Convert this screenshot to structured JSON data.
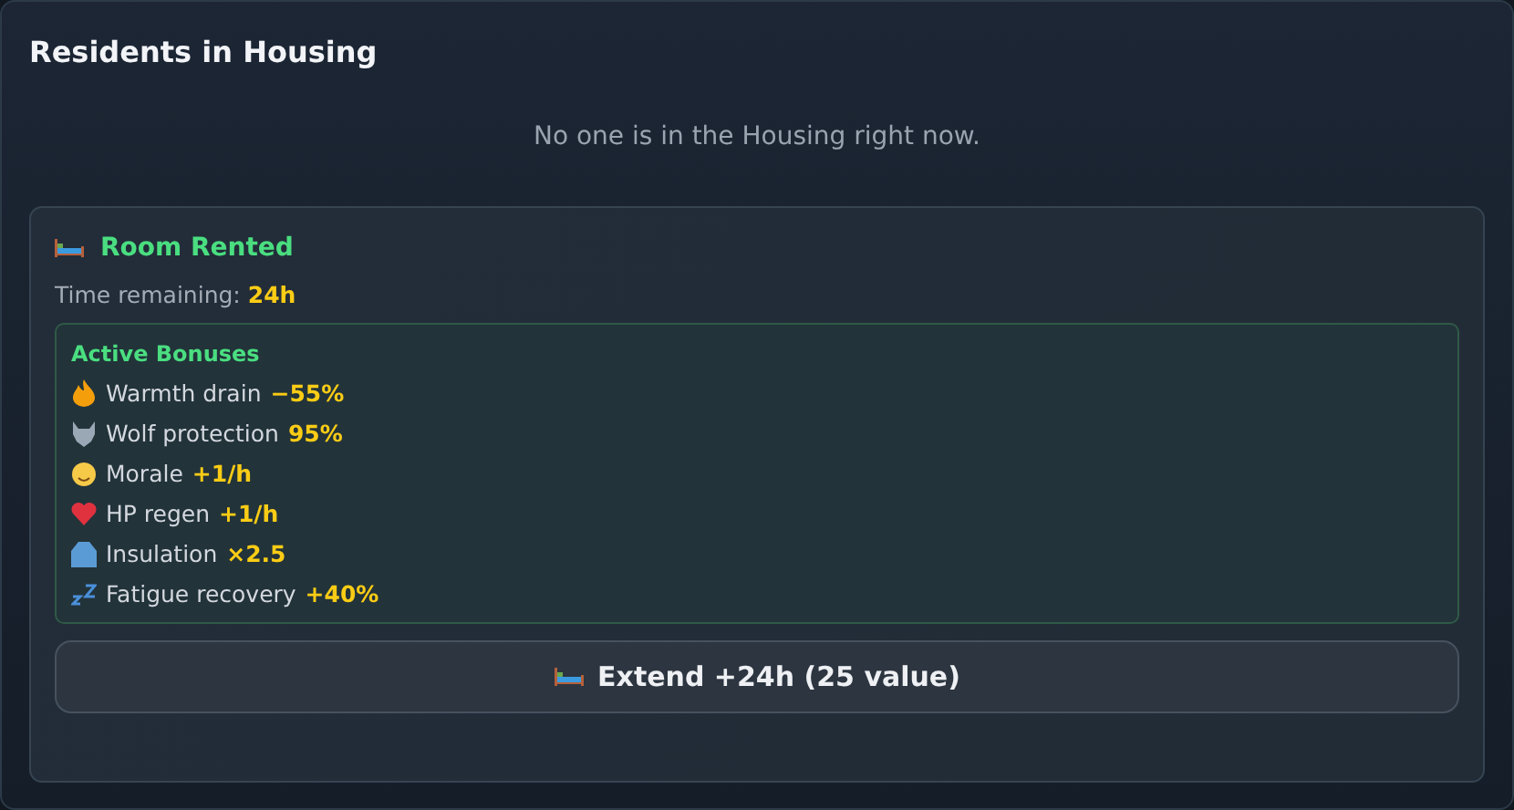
{
  "panel": {
    "title": "Residents in Housing",
    "empty_message": "No one is in the Housing right now."
  },
  "rental": {
    "title": "Room Rented",
    "time_label": "Time remaining:",
    "time_value": "24h",
    "bonuses_title": "Active Bonuses",
    "bonuses": [
      {
        "label": "Warmth drain",
        "value": "−55%"
      },
      {
        "label": "Wolf protection",
        "value": "95%"
      },
      {
        "label": "Morale",
        "value": "+1/h"
      },
      {
        "label": "HP regen",
        "value": "+1/h"
      },
      {
        "label": "Insulation",
        "value": "×2.5"
      },
      {
        "label": "Fatigue recovery",
        "value": "+40%"
      }
    ],
    "button": "Extend +24h (25 value)"
  }
}
